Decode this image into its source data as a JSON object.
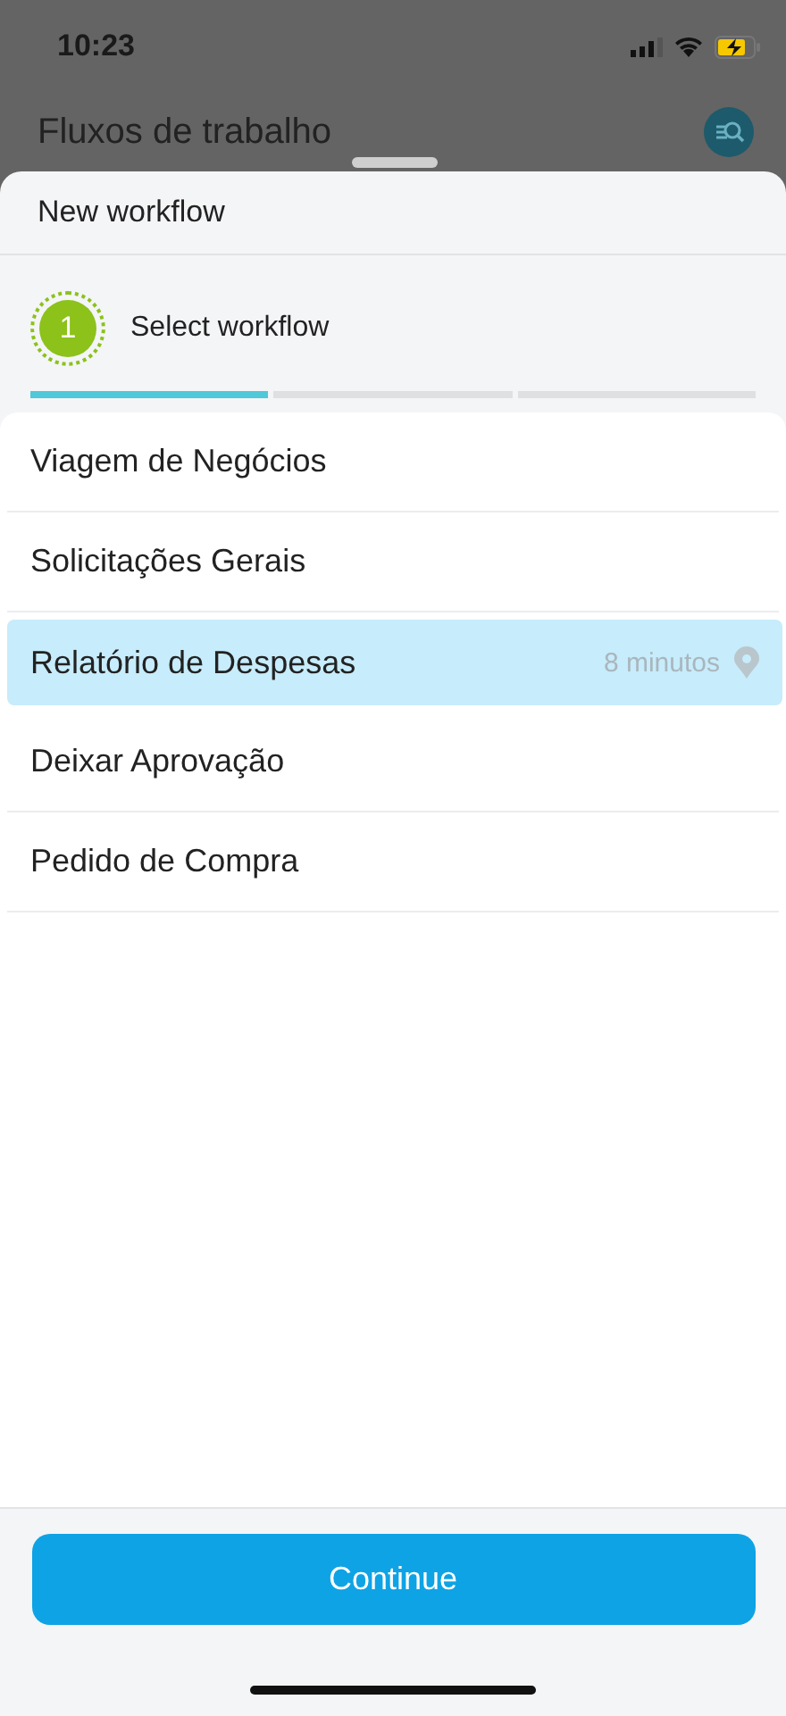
{
  "status_bar": {
    "time": "10:23"
  },
  "header": {
    "title": "Fluxos de trabalho"
  },
  "sheet": {
    "title": "New workflow",
    "step": {
      "number": "1",
      "label": "Select workflow"
    },
    "progress": [
      {
        "done": true
      },
      {
        "done": false
      },
      {
        "done": false
      }
    ],
    "workflows": [
      {
        "label": "Viagem de Negócios",
        "selected": false
      },
      {
        "label": "Solicitações Gerais",
        "selected": false
      },
      {
        "label": "Relatório de Despesas",
        "selected": true,
        "hint": "8 minutos"
      },
      {
        "label": "Deixar Aprovação",
        "selected": false
      },
      {
        "label": "Pedido de Compra",
        "selected": false
      }
    ],
    "button": "Continue"
  }
}
